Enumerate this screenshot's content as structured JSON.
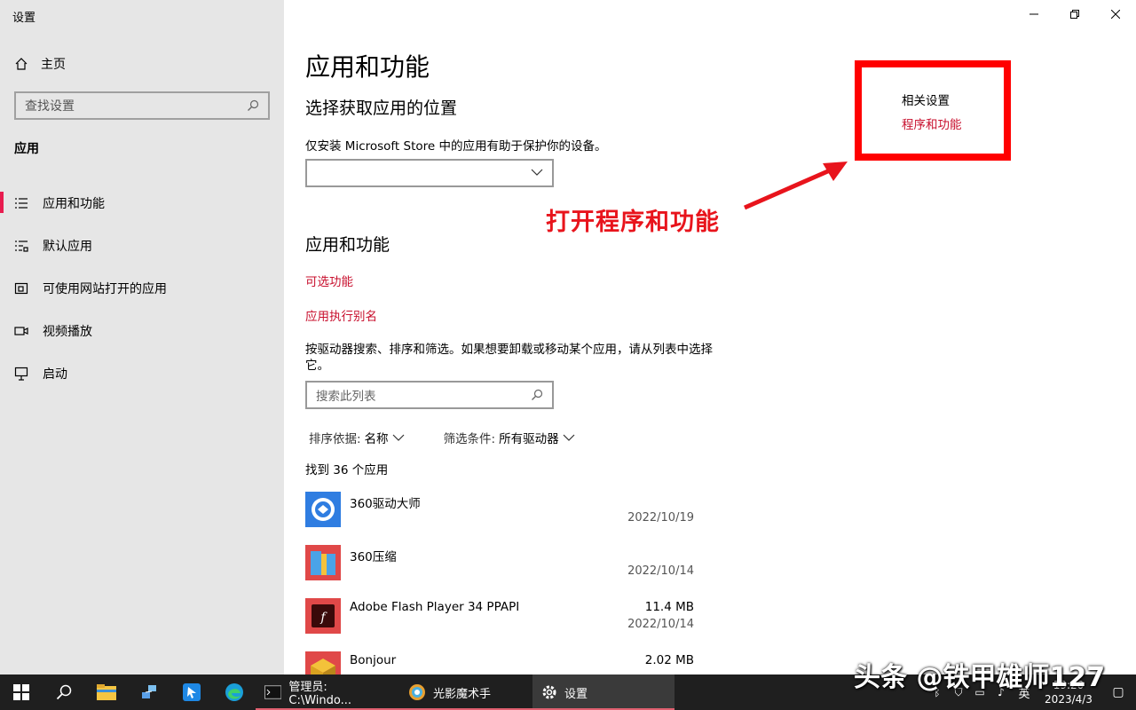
{
  "window": {
    "title": "设置",
    "controls": {
      "minimize": "—",
      "restore": "❐",
      "close": "✕"
    }
  },
  "sidebar": {
    "home_label": "主页",
    "search_placeholder": "查找设置",
    "section_title": "应用",
    "items": [
      {
        "label": "应用和功能",
        "icon": "list-icon",
        "active": true
      },
      {
        "label": "默认应用",
        "icon": "default-apps-icon",
        "active": false
      },
      {
        "label": "可使用网站打开的应用",
        "icon": "website-apps-icon",
        "active": false
      },
      {
        "label": "视频播放",
        "icon": "video-icon",
        "active": false
      },
      {
        "label": "启动",
        "icon": "startup-icon",
        "active": false
      }
    ]
  },
  "main": {
    "title": "应用和功能",
    "install_location": {
      "heading": "选择获取应用的位置",
      "description": "仅安装 Microsoft Store 中的应用有助于保护你的设备。",
      "dropdown_value": ""
    },
    "apps_section": {
      "heading": "应用和功能",
      "link_optional": "可选功能",
      "link_alias": "应用执行别名",
      "description": "按驱动器搜索、排序和筛选。如果想要卸载或移动某个应用，请从列表中选择它。",
      "search_placeholder": "搜索此列表",
      "sort_label": "排序依据:",
      "sort_value": "名称",
      "filter_label": "筛选条件:",
      "filter_value": "所有驱动器",
      "count_text": "找到 36 个应用",
      "apps": [
        {
          "name": "360驱动大师",
          "size": "",
          "date": "2022/10/19",
          "icon": "driver-master-icon"
        },
        {
          "name": "360压缩",
          "size": "",
          "date": "2022/10/14",
          "icon": "zip-icon"
        },
        {
          "name": "Adobe Flash Player 34 PPAPI",
          "size": "11.4 MB",
          "date": "2022/10/14",
          "icon": "flash-icon"
        },
        {
          "name": "Bonjour",
          "size": "2.02 MB",
          "date": "",
          "icon": "bonjour-icon"
        }
      ]
    }
  },
  "related": {
    "title": "相关设置",
    "link": "程序和功能"
  },
  "annotation": {
    "text": "打开程序和功能",
    "color": "#e8141c"
  },
  "taskbar": {
    "apps": [
      {
        "label": "管理员: C:\\Windo...",
        "icon": "cmd-icon"
      },
      {
        "label": "光影魔术手",
        "icon": "photo-editor-icon"
      },
      {
        "label": "设置",
        "icon": "gear-icon"
      }
    ],
    "ime": "英",
    "time": "19:20",
    "date": "2023/4/3"
  },
  "watermark": "头条 @铁甲雄师127",
  "colors": {
    "accent": "#e81c4f",
    "link": "#c8102e",
    "highlight_box": "#ff0000"
  }
}
